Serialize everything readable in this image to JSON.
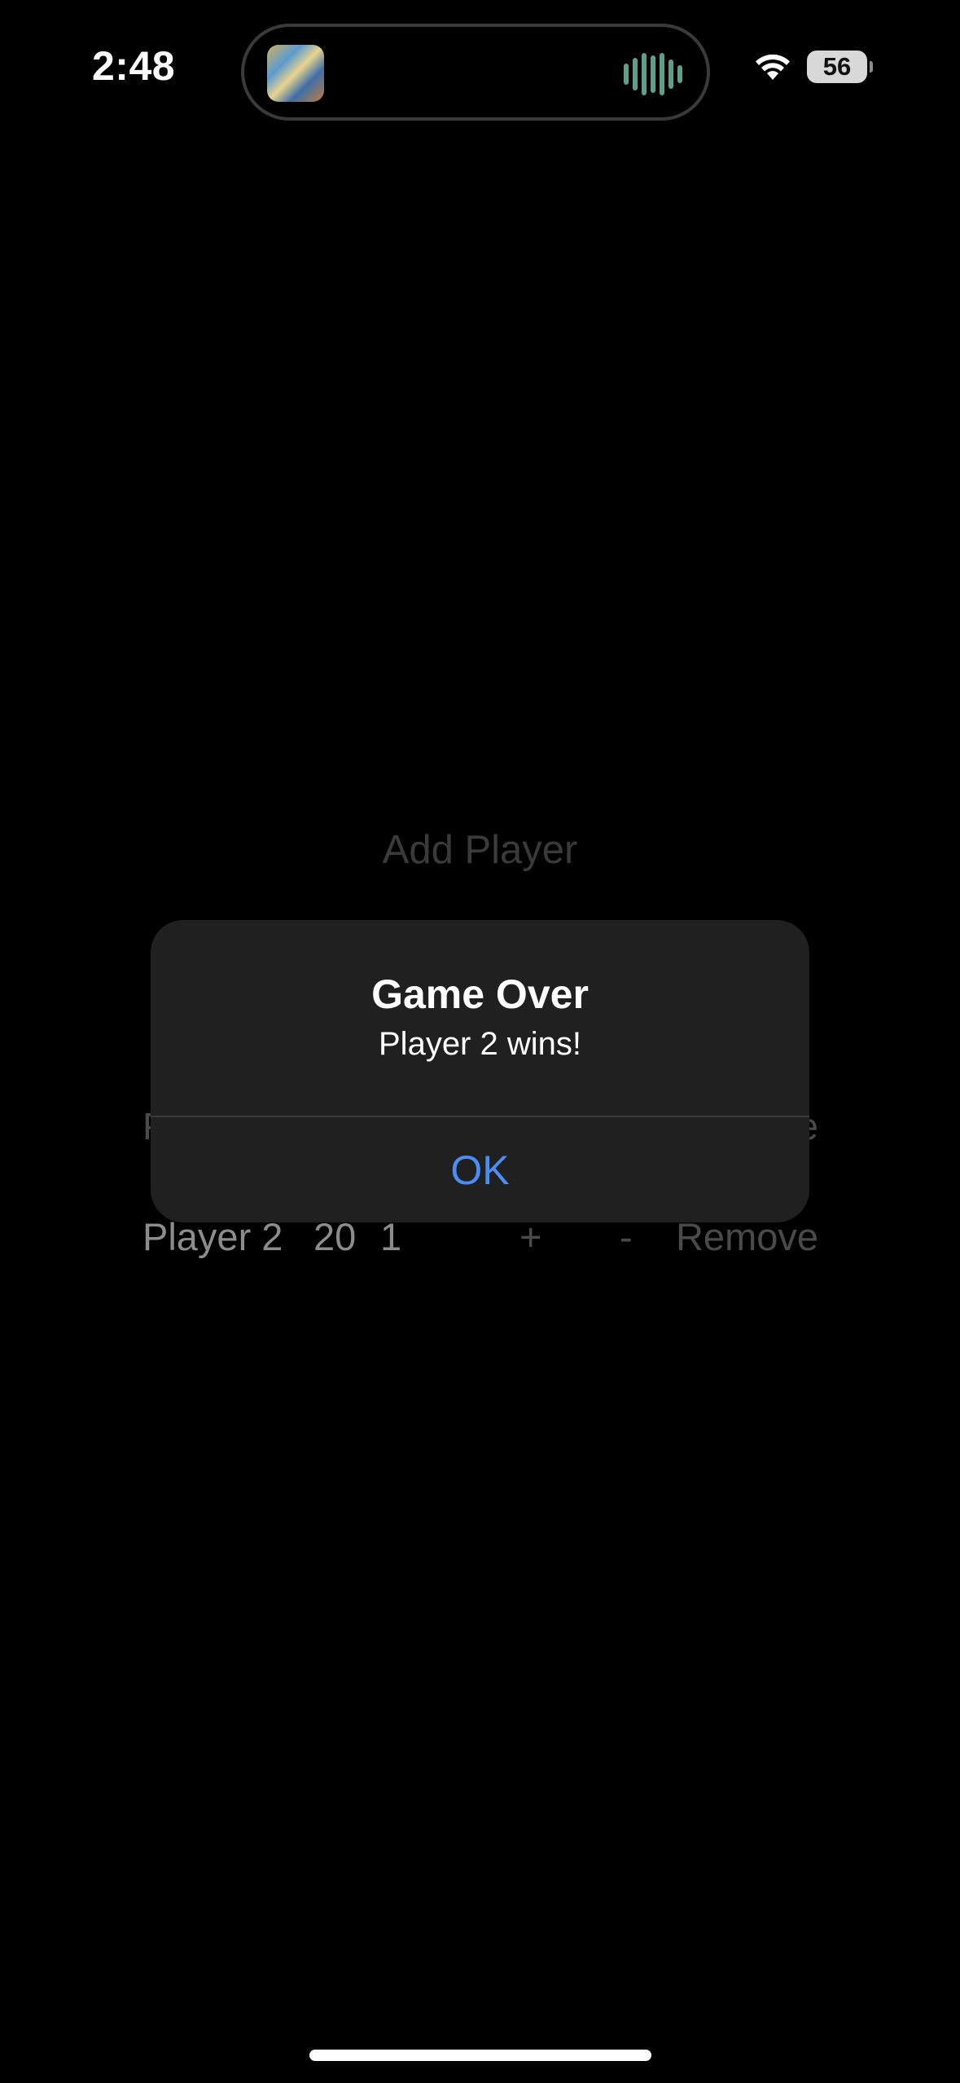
{
  "status_bar": {
    "time": "2:48",
    "battery_level": "56",
    "icons": [
      "album-art-icon",
      "audio-waveform-icon",
      "wifi-icon",
      "battery-icon"
    ]
  },
  "app": {
    "add_player_label": "Add Player",
    "header_left_fragment": "P",
    "header_right_fragment": "e",
    "player_row": {
      "name": "Player 2",
      "life": "20",
      "rank": "1",
      "plus_label": "+",
      "minus_label": "-",
      "remove_label": "Remove"
    }
  },
  "alert": {
    "title": "Game Over",
    "message": "Player 2 wins!",
    "ok_label": "OK",
    "accent_color": "#4a8ef5"
  }
}
